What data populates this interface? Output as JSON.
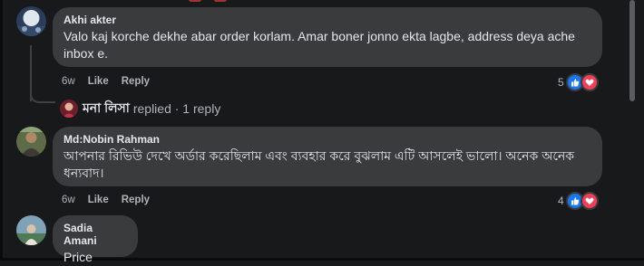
{
  "comments": [
    {
      "author": "Akhi akter",
      "text": "Valo kaj korche dekhe abar order korlam. Amar boner jonno ekta lagbe, address deya ache inbox e.",
      "time": "6w",
      "like_label": "Like",
      "reply_label": "Reply",
      "reaction_count": "5"
    },
    {
      "author": "Md:Nobin Rahman",
      "text": "আপনার রিভিউ দেখে অর্ডার করেছিলাম এবং ব্যবহার করে বুঝলাম এটি আসলেই ভালো। অনেক অনেক ধন্যবাদ।",
      "time": "6w",
      "like_label": "Like",
      "reply_label": "Reply",
      "reaction_count": "4"
    },
    {
      "author": "Sadia Amani",
      "text": "Price"
    }
  ],
  "reply_summary": {
    "name": "মনা লিসা",
    "suffix": "replied · 1 reply"
  },
  "colors": {
    "background": "#18191a",
    "bubble": "#3a3b3c",
    "like": "#1877f2",
    "love": "#f33e58"
  },
  "icons": [
    "like-reaction-icon",
    "love-reaction-icon"
  ]
}
